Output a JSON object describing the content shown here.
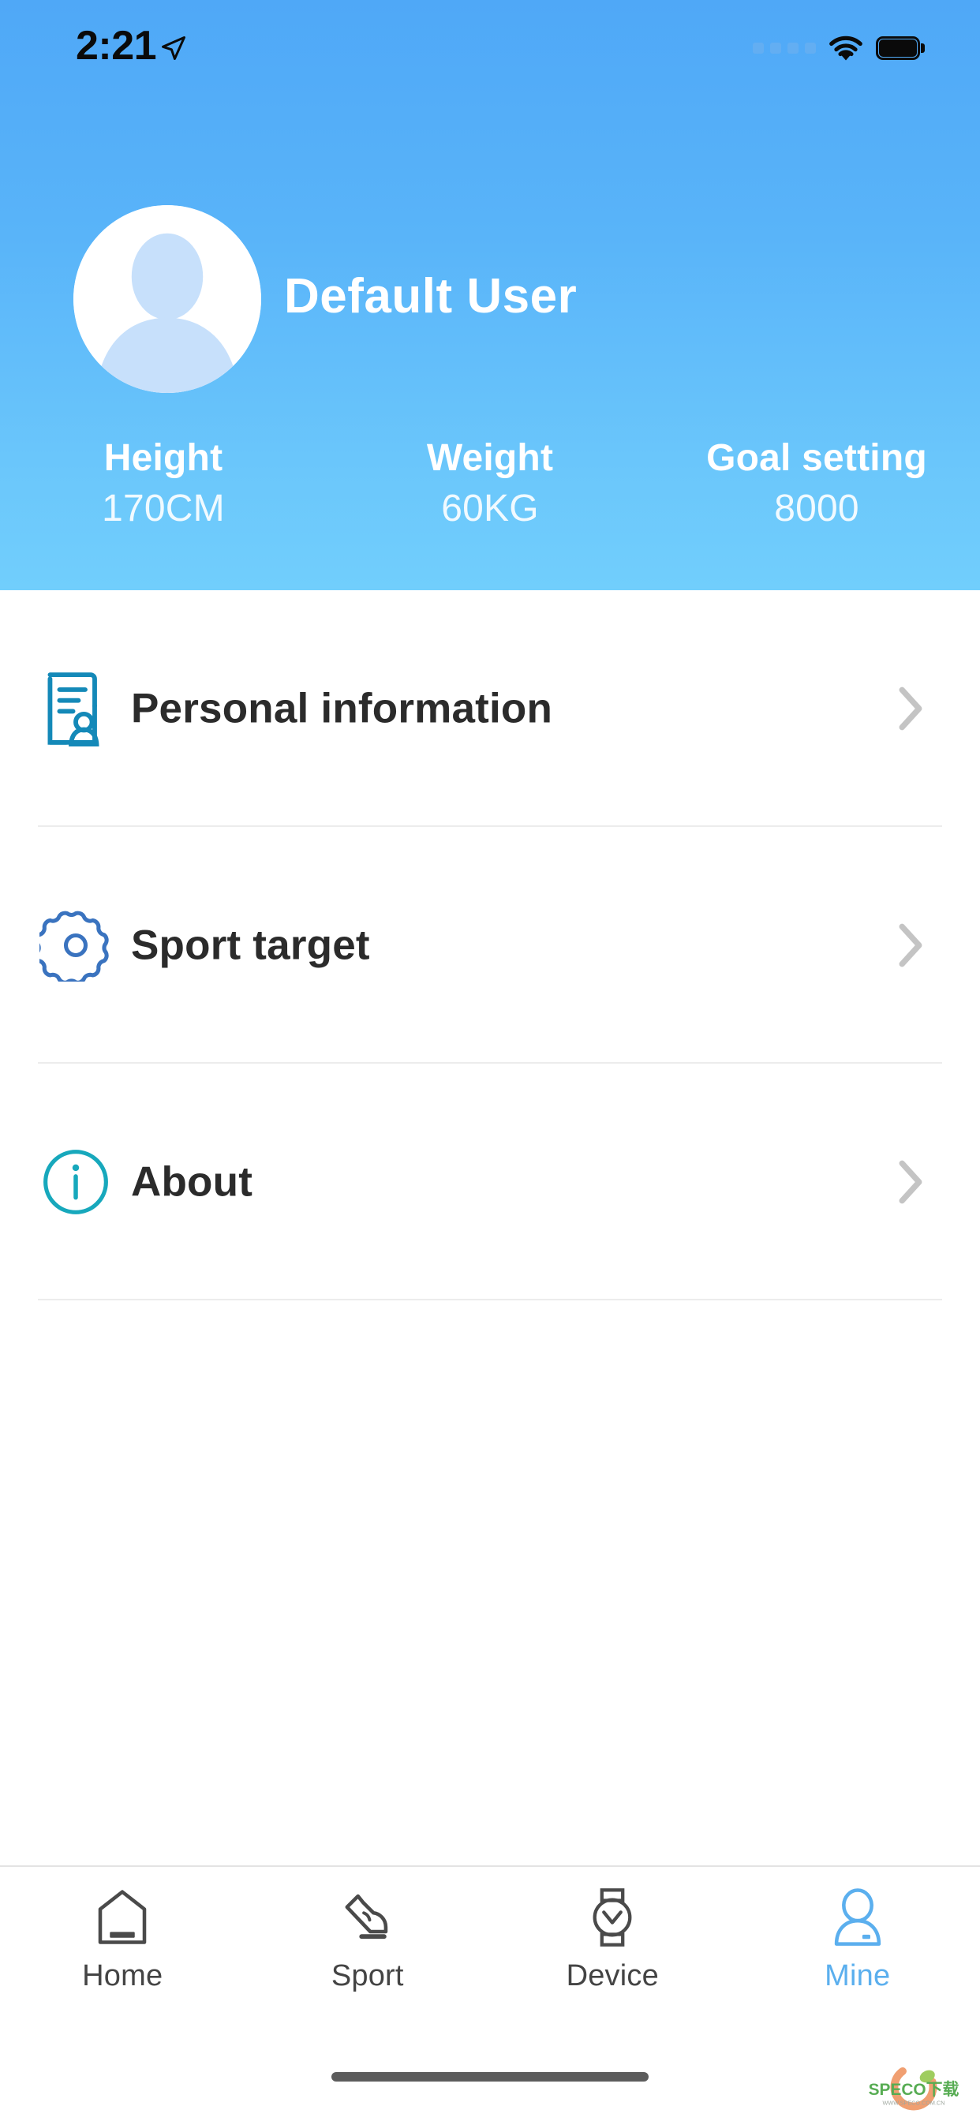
{
  "status_bar": {
    "time": "2:21",
    "location_icon": "location-arrow-icon",
    "signal_icon": "signal-dots-icon",
    "wifi_icon": "wifi-icon",
    "battery_icon": "battery-full-icon"
  },
  "header": {
    "avatar_icon": "default-avatar-icon",
    "username": "Default User",
    "stats": [
      {
        "label": "Height",
        "value": "170CM"
      },
      {
        "label": "Weight",
        "value": "60KG"
      },
      {
        "label": "Goal setting",
        "value": "8000"
      }
    ]
  },
  "menu": {
    "items": [
      {
        "label": "Personal information",
        "icon": "document-person-icon",
        "chevron": "chevron-right-icon"
      },
      {
        "label": "Sport target",
        "icon": "gear-icon",
        "chevron": "chevron-right-icon"
      },
      {
        "label": "About",
        "icon": "info-circle-icon",
        "chevron": "chevron-right-icon"
      }
    ]
  },
  "tabbar": {
    "tabs": [
      {
        "label": "Home",
        "icon": "house-icon",
        "active": false
      },
      {
        "label": "Sport",
        "icon": "shoe-icon",
        "active": false
      },
      {
        "label": "Device",
        "icon": "watch-icon",
        "active": false
      },
      {
        "label": "Mine",
        "icon": "person-icon",
        "active": true
      }
    ]
  },
  "watermark": {
    "brand": "SPECO下载",
    "url": "WWW.SPECO.COM.CN"
  },
  "colors": {
    "header_gradient_start": "#4FA8F7",
    "header_gradient_end": "#71CEFC",
    "accent_active": "#5BAFEE",
    "icon_personal": "#1489B8",
    "icon_sport": "#3A73BF",
    "icon_about": "#17A8BC",
    "text_primary": "#2b2b2b",
    "divider": "#ececec"
  }
}
